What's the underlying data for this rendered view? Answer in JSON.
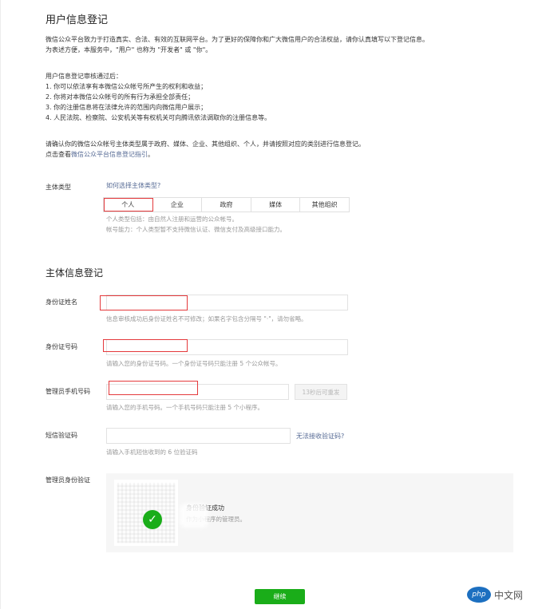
{
  "page": {
    "title": "用户信息登记",
    "intro_lines": [
      "微信公众平台致力于打造真实、合法、有效的互联网平台。为了更好的保障你和广大微信用户的合法权益，请你认真填写以下登记信息。",
      "为表述方便，本服务中，\"用户\" 也称为 \"开发者\" 或 \"你\"。"
    ],
    "review_heading": "用户信息登记审核通过后：",
    "review_items": [
      "1. 你可以依法享有本微信公众帐号所产生的权利和收益；",
      "2. 你将对本微信公众帐号的所有行为承担全部责任；",
      "3. 你的注册信息将在法律允许的范围内向微信用户展示；",
      "4. 人民法院、检察院、公安机关等有权机关可向腾讯依法调取你的注册信息等。"
    ],
    "confirm_line": "请确认你的微信公众帐号主体类型属于政府、媒体、企业、其他组织、个人，并请按照对应的类别进行信息登记。",
    "guide_prefix": "点击查看",
    "guide_link": "微信公众平台信息登记指引",
    "guide_suffix": "。"
  },
  "subject_type": {
    "label": "主体类型",
    "help_link": "如何选择主体类型?",
    "tabs": [
      "个人",
      "企业",
      "政府",
      "媒体",
      "其他组织"
    ],
    "selected": "个人",
    "tip_1": "个人类型包括：由自然人注册和运营的公众帐号。",
    "tip_2": "帐号能力：个人类型暂不支持微信认证、微信支付及高级接口能力。"
  },
  "subject_info": {
    "heading": "主体信息登记",
    "id_name": {
      "label": "身份证姓名",
      "value": "",
      "tip": "信息审核成功后身份证姓名不可修改；如果名字包含分隔号 \"·\"，请勿省略。"
    },
    "id_number": {
      "label": "身份证号码",
      "value": "",
      "tip": "请输入您的身份证号码。一个身份证号码只能注册 5 个公众帐号。"
    },
    "admin_phone": {
      "label": "管理员手机号码",
      "value": "",
      "resend_label": "13秒后可重发",
      "tip": "请输入您的手机号码。一个手机号码只能注册 5 个小程序。"
    },
    "sms_code": {
      "label": "短信验证码",
      "value": "",
      "help_link": "无法接收验证码?",
      "tip": "请输入手机短信收到的 6 位验证码"
    },
    "admin_verify": {
      "label": "管理员身份验证",
      "status_title": "身份验证成功",
      "status_sub": "作为小程序的管理员。"
    }
  },
  "submit_label": "继续",
  "watermark": {
    "badge": "php",
    "text": "中文网"
  },
  "colors": {
    "accent_green": "#1aad19",
    "link_blue": "#576b95",
    "highlight_red": "#e4393c"
  }
}
